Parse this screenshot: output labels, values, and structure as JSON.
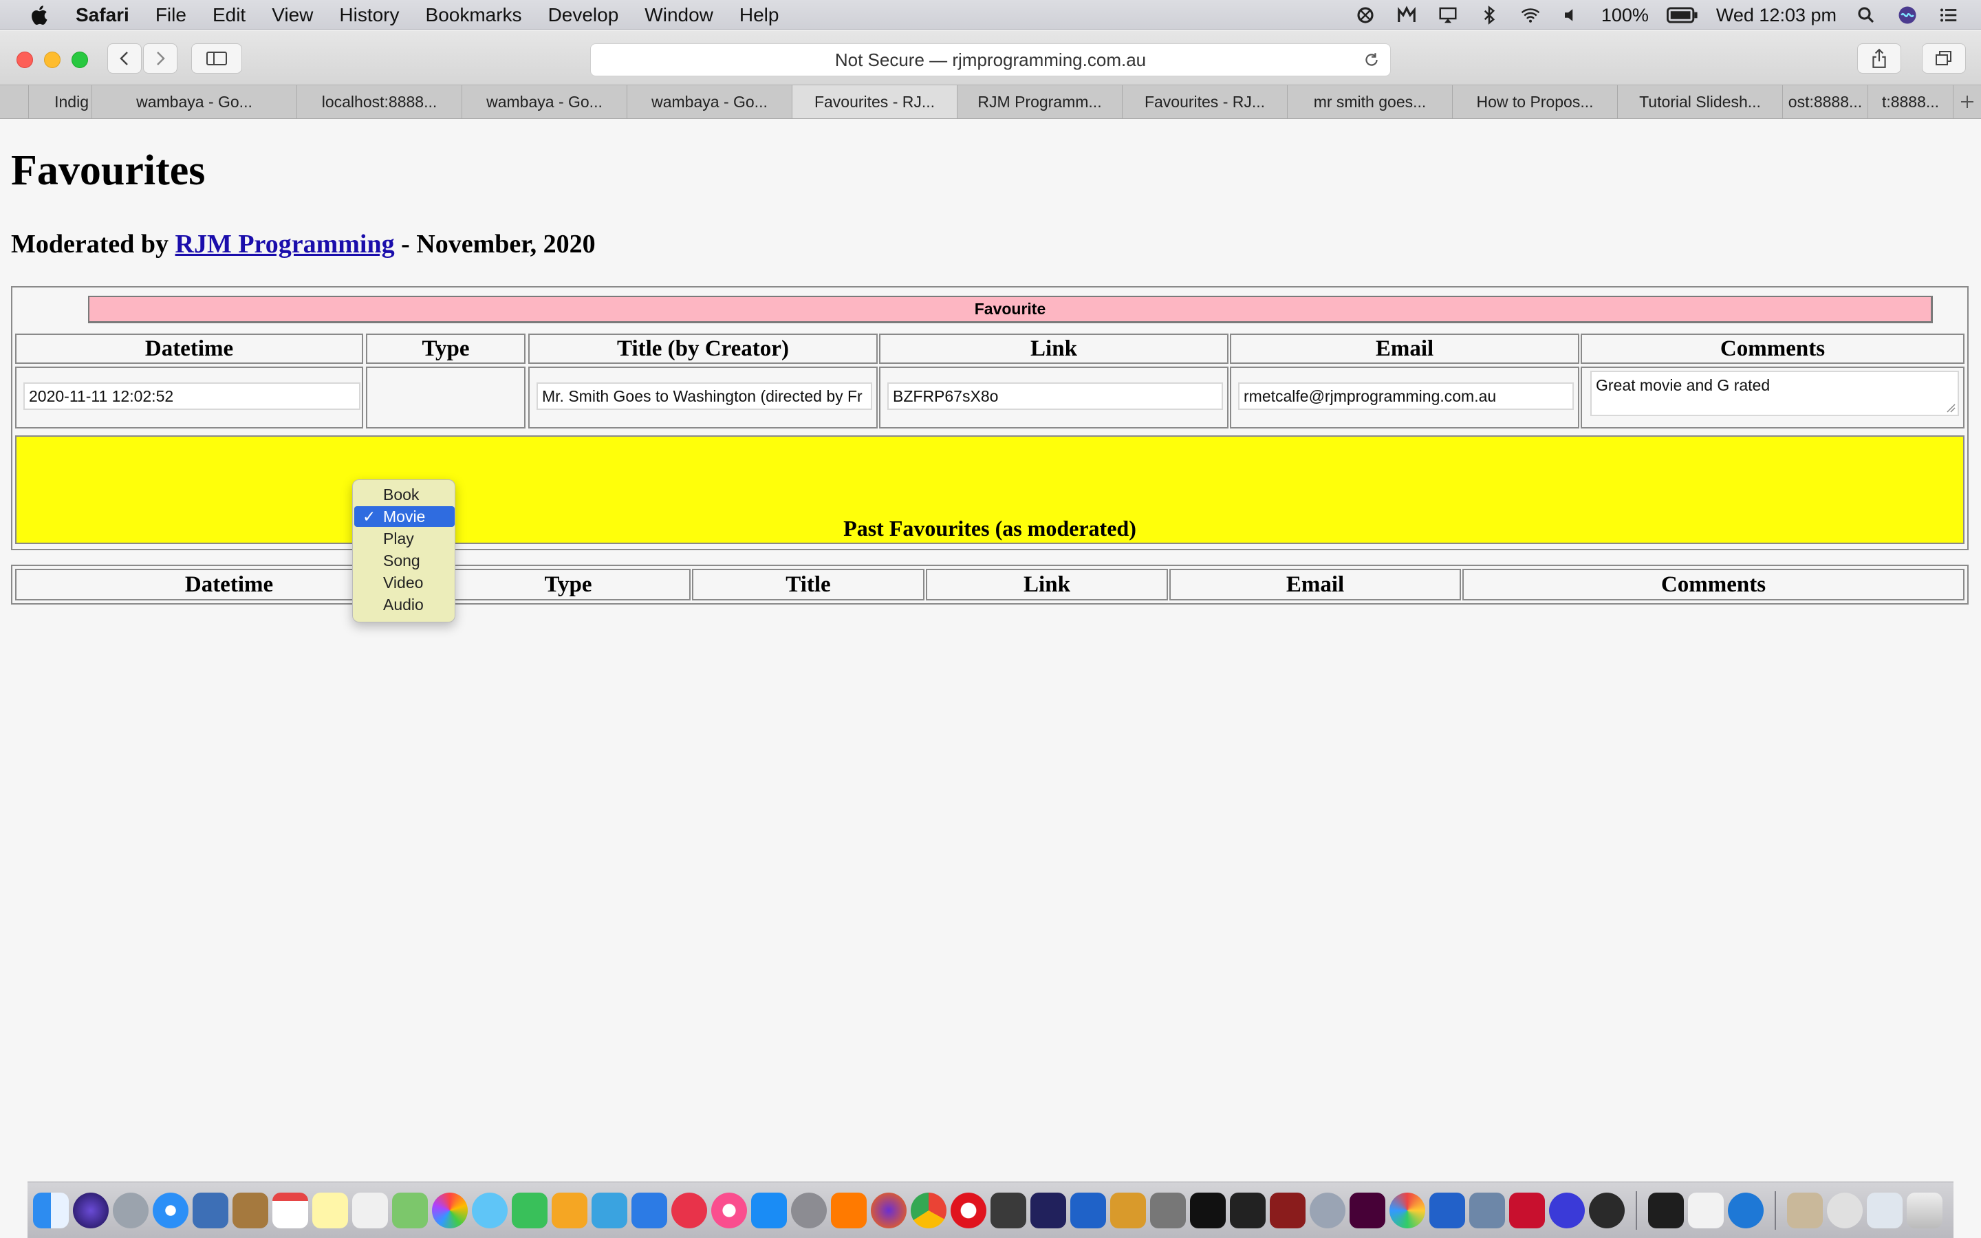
{
  "menubar": {
    "app": "Safari",
    "items": [
      "File",
      "Edit",
      "View",
      "History",
      "Bookmarks",
      "Develop",
      "Window",
      "Help"
    ],
    "battery": "100%",
    "clock": "Wed 12:03 pm"
  },
  "toolbar": {
    "url": "Not Secure — rjmprogramming.com.au"
  },
  "tabs": [
    {
      "label": "Indig"
    },
    {
      "label": "wambaya - Go..."
    },
    {
      "label": "localhost:8888..."
    },
    {
      "label": "wambaya - Go..."
    },
    {
      "label": "wambaya - Go..."
    },
    {
      "label": "Favourites - RJ..."
    },
    {
      "label": "RJM Programm..."
    },
    {
      "label": "Favourites - RJ..."
    },
    {
      "label": "mr smith goes..."
    },
    {
      "label": "How to Propos..."
    },
    {
      "label": "Tutorial Slidesh..."
    },
    {
      "label": "ost:8888..."
    },
    {
      "label": "t:8888..."
    }
  ],
  "page": {
    "title": "Favourites",
    "subtitle_prefix": "Moderated by ",
    "subtitle_link": "RJM Programming",
    "subtitle_suffix": " - November, 2020",
    "favourite_button": "Favourite",
    "headers": {
      "datetime": "Datetime",
      "type": "Type",
      "title": "Title (by Creator)",
      "link": "Link",
      "email": "Email",
      "comments": "Comments"
    },
    "form": {
      "datetime": "2020-11-11 12:02:52",
      "title": "Mr. Smith Goes to Washington (directed by Fr",
      "link": "BZFRP67sX8o",
      "email": "rmetcalfe@rjmprogramming.com.au",
      "comments": "Great movie and G rated"
    },
    "type_options": [
      "Book",
      "Movie",
      "Play",
      "Song",
      "Video",
      "Audio"
    ],
    "type_selected": "Movie",
    "check": "✓",
    "past_title": "Past Favourites (as moderated)",
    "past_headers": {
      "datetime": "Datetime",
      "type": "Type",
      "title": "Title",
      "link": "Link",
      "email": "Email",
      "comments": "Comments"
    }
  },
  "colors": {
    "favourite_bar": "#fdb6c2",
    "past_banner": "#ffff0a",
    "selection": "#2f6ce0",
    "popup": "#ecedba"
  }
}
